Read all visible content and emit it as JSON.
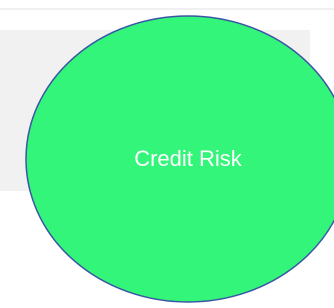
{
  "diagram": {
    "node": {
      "label": "Credit Risk",
      "fill_color": "#33f57a",
      "stroke_color": "#3a56a6"
    },
    "panel_color": "#f1f1f1"
  }
}
